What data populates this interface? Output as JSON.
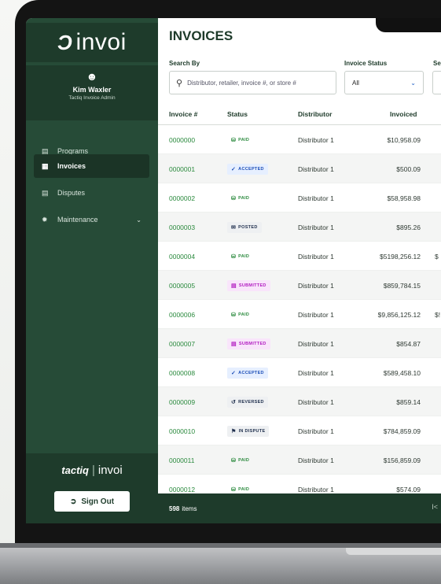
{
  "brand": {
    "logo_text": "invoi",
    "logo_mark": "Ͻ"
  },
  "user": {
    "name": "Kim Waxler",
    "role": "Tactiq Invoice Admin"
  },
  "nav": [
    {
      "label": "Programs",
      "icon": "programs-icon",
      "active": false
    },
    {
      "label": "Invoices",
      "icon": "invoices-icon",
      "active": true
    },
    {
      "label": "Disputes",
      "icon": "disputes-icon",
      "active": false
    },
    {
      "label": "Maintenance",
      "icon": "maintenance-icon",
      "active": false,
      "has_chevron": true
    }
  ],
  "footer_logo": {
    "left": "tactiq",
    "divider": "|",
    "right": "invoi"
  },
  "signout": {
    "label": "Sign Out"
  },
  "page": {
    "title": "INVOICES"
  },
  "filters": {
    "search_label": "Search By",
    "search_placeholder": "Distributor, retailer, invoice #, or store #",
    "status_label": "Invoice Status",
    "status_value": "All",
    "third_label": "Se"
  },
  "table": {
    "headers": [
      "Invoice #",
      "Status",
      "Distributor",
      "Invoiced"
    ],
    "rows": [
      {
        "invoice": "0000000",
        "status": "PAID",
        "status_type": "paid",
        "distributor": "Distributor 1",
        "invoiced": "$10,958.09",
        "extra": ""
      },
      {
        "invoice": "0000001",
        "status": "ACCEPTED",
        "status_type": "accepted",
        "distributor": "Distributor 1",
        "invoiced": "$500.09",
        "extra": ""
      },
      {
        "invoice": "0000002",
        "status": "PAID",
        "status_type": "paid",
        "distributor": "Distributor 1",
        "invoiced": "$58,958.98",
        "extra": ""
      },
      {
        "invoice": "0000003",
        "status": "POSTED",
        "status_type": "posted",
        "distributor": "Distributor 1",
        "invoiced": "$895.26",
        "extra": ""
      },
      {
        "invoice": "0000004",
        "status": "PAID",
        "status_type": "paid",
        "distributor": "Distributor 1",
        "invoiced": "$5198,256.12",
        "extra": "$"
      },
      {
        "invoice": "0000005",
        "status": "SUBMITTED",
        "status_type": "submitted",
        "distributor": "Distributor 1",
        "invoiced": "$859,784.15",
        "extra": ""
      },
      {
        "invoice": "0000006",
        "status": "PAID",
        "status_type": "paid",
        "distributor": "Distributor 1",
        "invoiced": "$9,856,125.12",
        "extra": "$!"
      },
      {
        "invoice": "0000007",
        "status": "SUBMITTED",
        "status_type": "submitted",
        "distributor": "Distributor 1",
        "invoiced": "$854.87",
        "extra": ""
      },
      {
        "invoice": "0000008",
        "status": "ACCEPTED",
        "status_type": "accepted",
        "distributor": "Distributor 1",
        "invoiced": "$589,458.10",
        "extra": ""
      },
      {
        "invoice": "0000009",
        "status": "REVERSED",
        "status_type": "reversed",
        "distributor": "Distributor 1",
        "invoiced": "$859.14",
        "extra": ""
      },
      {
        "invoice": "0000010",
        "status": "IN DISPUTE",
        "status_type": "dispute",
        "distributor": "Distributor 1",
        "invoiced": "$784,859.09",
        "extra": ""
      },
      {
        "invoice": "0000011",
        "status": "PAID",
        "status_type": "paid",
        "distributor": "Distributor 1",
        "invoiced": "$156,859.09",
        "extra": ""
      },
      {
        "invoice": "0000012",
        "status": "PAID",
        "status_type": "paid",
        "distributor": "Distributor 1",
        "invoiced": "$574.09",
        "extra": ""
      }
    ]
  },
  "footer": {
    "count": "598",
    "count_label": "items",
    "pager_symbol": "I<"
  },
  "icons": {
    "user": "user-icon",
    "search": "search-icon",
    "chevron": "chevron-down-icon",
    "signout": "sign-out-icon"
  },
  "colors": {
    "sidebar": "#264b37",
    "sidebar_dark": "#1e3b2b",
    "accent": "#2b8a3e",
    "title": "#1d3a29"
  }
}
